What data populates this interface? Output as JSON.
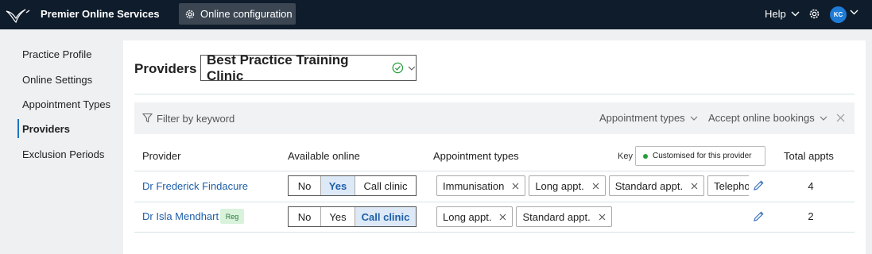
{
  "header": {
    "app_name": "Premier Online Services",
    "config_button": "Online configuration",
    "help_label": "Help",
    "user_initials": "KC"
  },
  "sidebar": {
    "items": [
      {
        "label": "Practice Profile"
      },
      {
        "label": "Online Settings"
      },
      {
        "label": "Appointment Types"
      },
      {
        "label": "Providers"
      },
      {
        "label": "Exclusion Periods"
      }
    ]
  },
  "main": {
    "title": "Providers",
    "clinic": "Best Practice Training Clinic",
    "filter": {
      "placeholder": "Filter by keyword",
      "appointment_types": "Appointment types",
      "accept_online": "Accept online bookings"
    },
    "table": {
      "headers": {
        "provider": "Provider",
        "available": "Available online",
        "appt_types": "Appointment types",
        "total": "Total appts"
      },
      "key_label": "Key",
      "key_text": "Customised for this provider",
      "availability_options": [
        "No",
        "Yes",
        "Call clinic"
      ],
      "rows": [
        {
          "name": "Dr Frederick Findacure",
          "selected": "Yes",
          "tags": [
            "Immunisation",
            "Long appt.",
            "Standard appt.",
            "Telephone"
          ],
          "total": "4"
        },
        {
          "name": "Dr Isla Mendhart",
          "badge": "Reg",
          "selected": "Call clinic",
          "tags": [
            "Long appt.",
            "Standard appt."
          ],
          "total": "2"
        }
      ]
    }
  },
  "colors": {
    "topbar": "#0f1c2b",
    "accent": "#1e73be",
    "link": "#1e5fa8",
    "selected_bg": "#dde9f7",
    "customised_dot": "#2a9d3e"
  }
}
